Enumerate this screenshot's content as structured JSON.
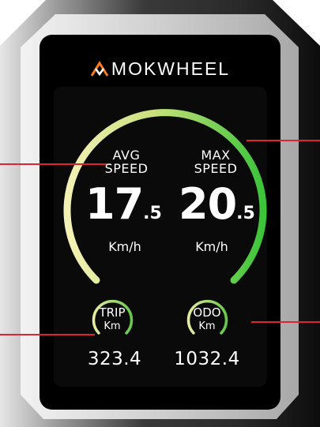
{
  "brand": {
    "name": "MOKWHEEL",
    "accent": "#ff7a1a"
  },
  "colors": {
    "screen_bg": "#000000",
    "text": "#ffffff",
    "arc_start": "#f2efb0",
    "arc_end": "#3cc43a",
    "callout_line": "#e0232e",
    "housing_light": "#d9d9d9",
    "housing_dark": "#1a1a1a"
  },
  "speedometer": {
    "avg": {
      "title_line1": "AVG",
      "title_line2": "SPEED",
      "value_int": "17",
      "value_dec": ".5",
      "unit": "Km/h"
    },
    "max": {
      "title_line1": "MAX",
      "title_line2": "SPEED",
      "value_int": "20",
      "value_dec": ".5",
      "unit": "Km/h"
    }
  },
  "trip": {
    "title": "TRIP",
    "unit": "Km",
    "value": "323.4"
  },
  "odo": {
    "title": "ODO",
    "unit": "Km",
    "value": "1032.4"
  }
}
